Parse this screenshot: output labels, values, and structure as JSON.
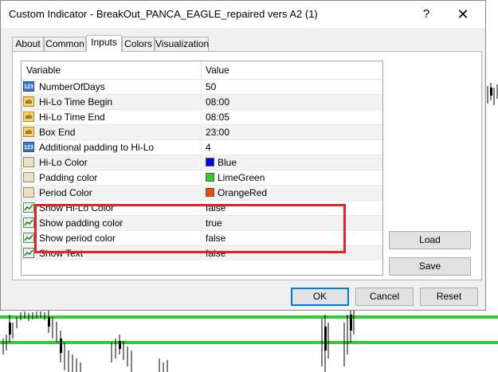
{
  "window": {
    "title": "Custom Indicator - BreakOut_PANCA_EAGLE_repaired vers A2 (1)",
    "help_label": "?",
    "close_label": "✕"
  },
  "tabs": [
    {
      "label": "About"
    },
    {
      "label": "Common"
    },
    {
      "label": "Inputs",
      "active": true
    },
    {
      "label": "Colors"
    },
    {
      "label": "Visualization"
    }
  ],
  "grid": {
    "col_variable": "Variable",
    "col_value": "Value",
    "rows": [
      {
        "icon": "123",
        "name": "NumberOfDays",
        "value": "50"
      },
      {
        "icon": "ab",
        "name": "Hi-Lo Time Begin",
        "value": "08:00"
      },
      {
        "icon": "ab",
        "name": "Hi-Lo Time End",
        "value": "08:05"
      },
      {
        "icon": "ab",
        "name": "Box End",
        "value": "23:00"
      },
      {
        "icon": "123",
        "name": "Additional padding to Hi-Lo",
        "value": "4"
      },
      {
        "icon": "color",
        "name": "Hi-Lo Color",
        "value": "Blue",
        "color": "#0000ff"
      },
      {
        "icon": "color",
        "name": "Padding color",
        "value": "LimeGreen",
        "color": "#32cd32"
      },
      {
        "icon": "color",
        "name": "Period Color",
        "value": "OrangeRed",
        "color": "#ff4500"
      },
      {
        "icon": "bool",
        "name": "Show Hi-Lo Color",
        "value": "false"
      },
      {
        "icon": "bool",
        "name": "Show padding color",
        "value": "true"
      },
      {
        "icon": "bool",
        "name": "Show period color",
        "value": "false"
      },
      {
        "icon": "bool",
        "name": "Show Text",
        "value": "false"
      }
    ]
  },
  "side_buttons": {
    "load_label": "Load",
    "save_label": "Save"
  },
  "footer": {
    "ok_label": "OK",
    "cancel_label": "Cancel",
    "reset_label": "Reset"
  },
  "colors": {
    "highlight": "#e8202a",
    "chart_line": "#33cc33",
    "accent": "#0078d7"
  }
}
